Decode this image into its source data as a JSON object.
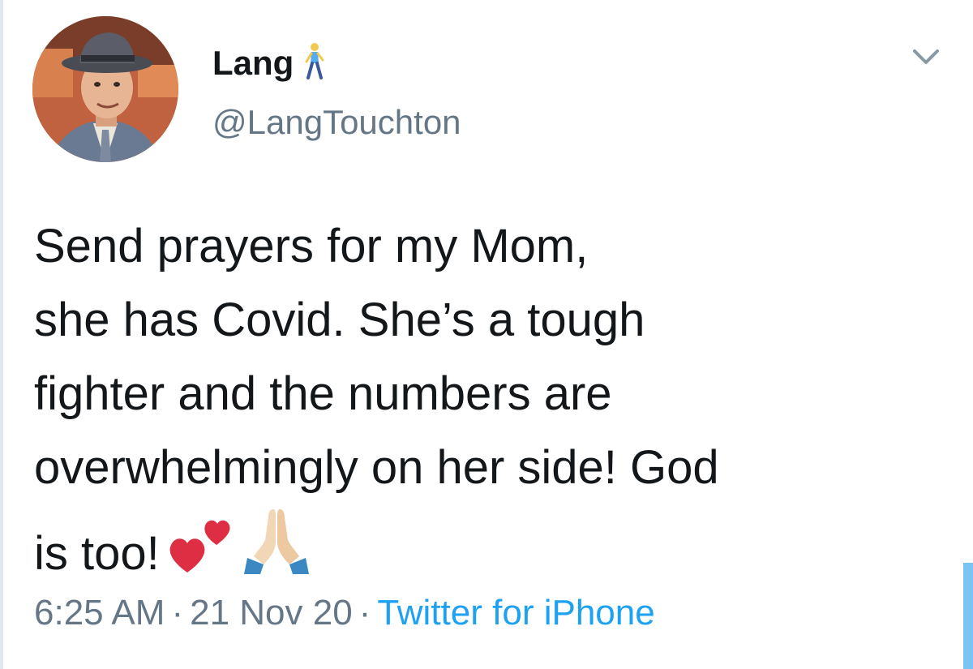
{
  "tweet": {
    "author": {
      "display_name": "Lang",
      "name_emoji": "person-walking-emoji",
      "handle": "@LangTouchton",
      "avatar": "avatar-photo"
    },
    "text_lines": [
      "Send prayers for my Mom,",
      "she has Covid. She’s a tough",
      "fighter and the numbers are",
      "overwhelmingly on her side! God",
      "is too!"
    ],
    "text_emojis": [
      "two-hearts-emoji",
      "folded-hands-emoji"
    ],
    "time": "6:25 AM",
    "date": "21 Nov 20",
    "separator": "·",
    "source": "Twitter for iPhone"
  },
  "icons": {
    "more_menu": "chevron-down-icon"
  },
  "colors": {
    "text": "#14171a",
    "secondary": "#657786",
    "link": "#1da1f2",
    "heart": "#e0245e"
  }
}
